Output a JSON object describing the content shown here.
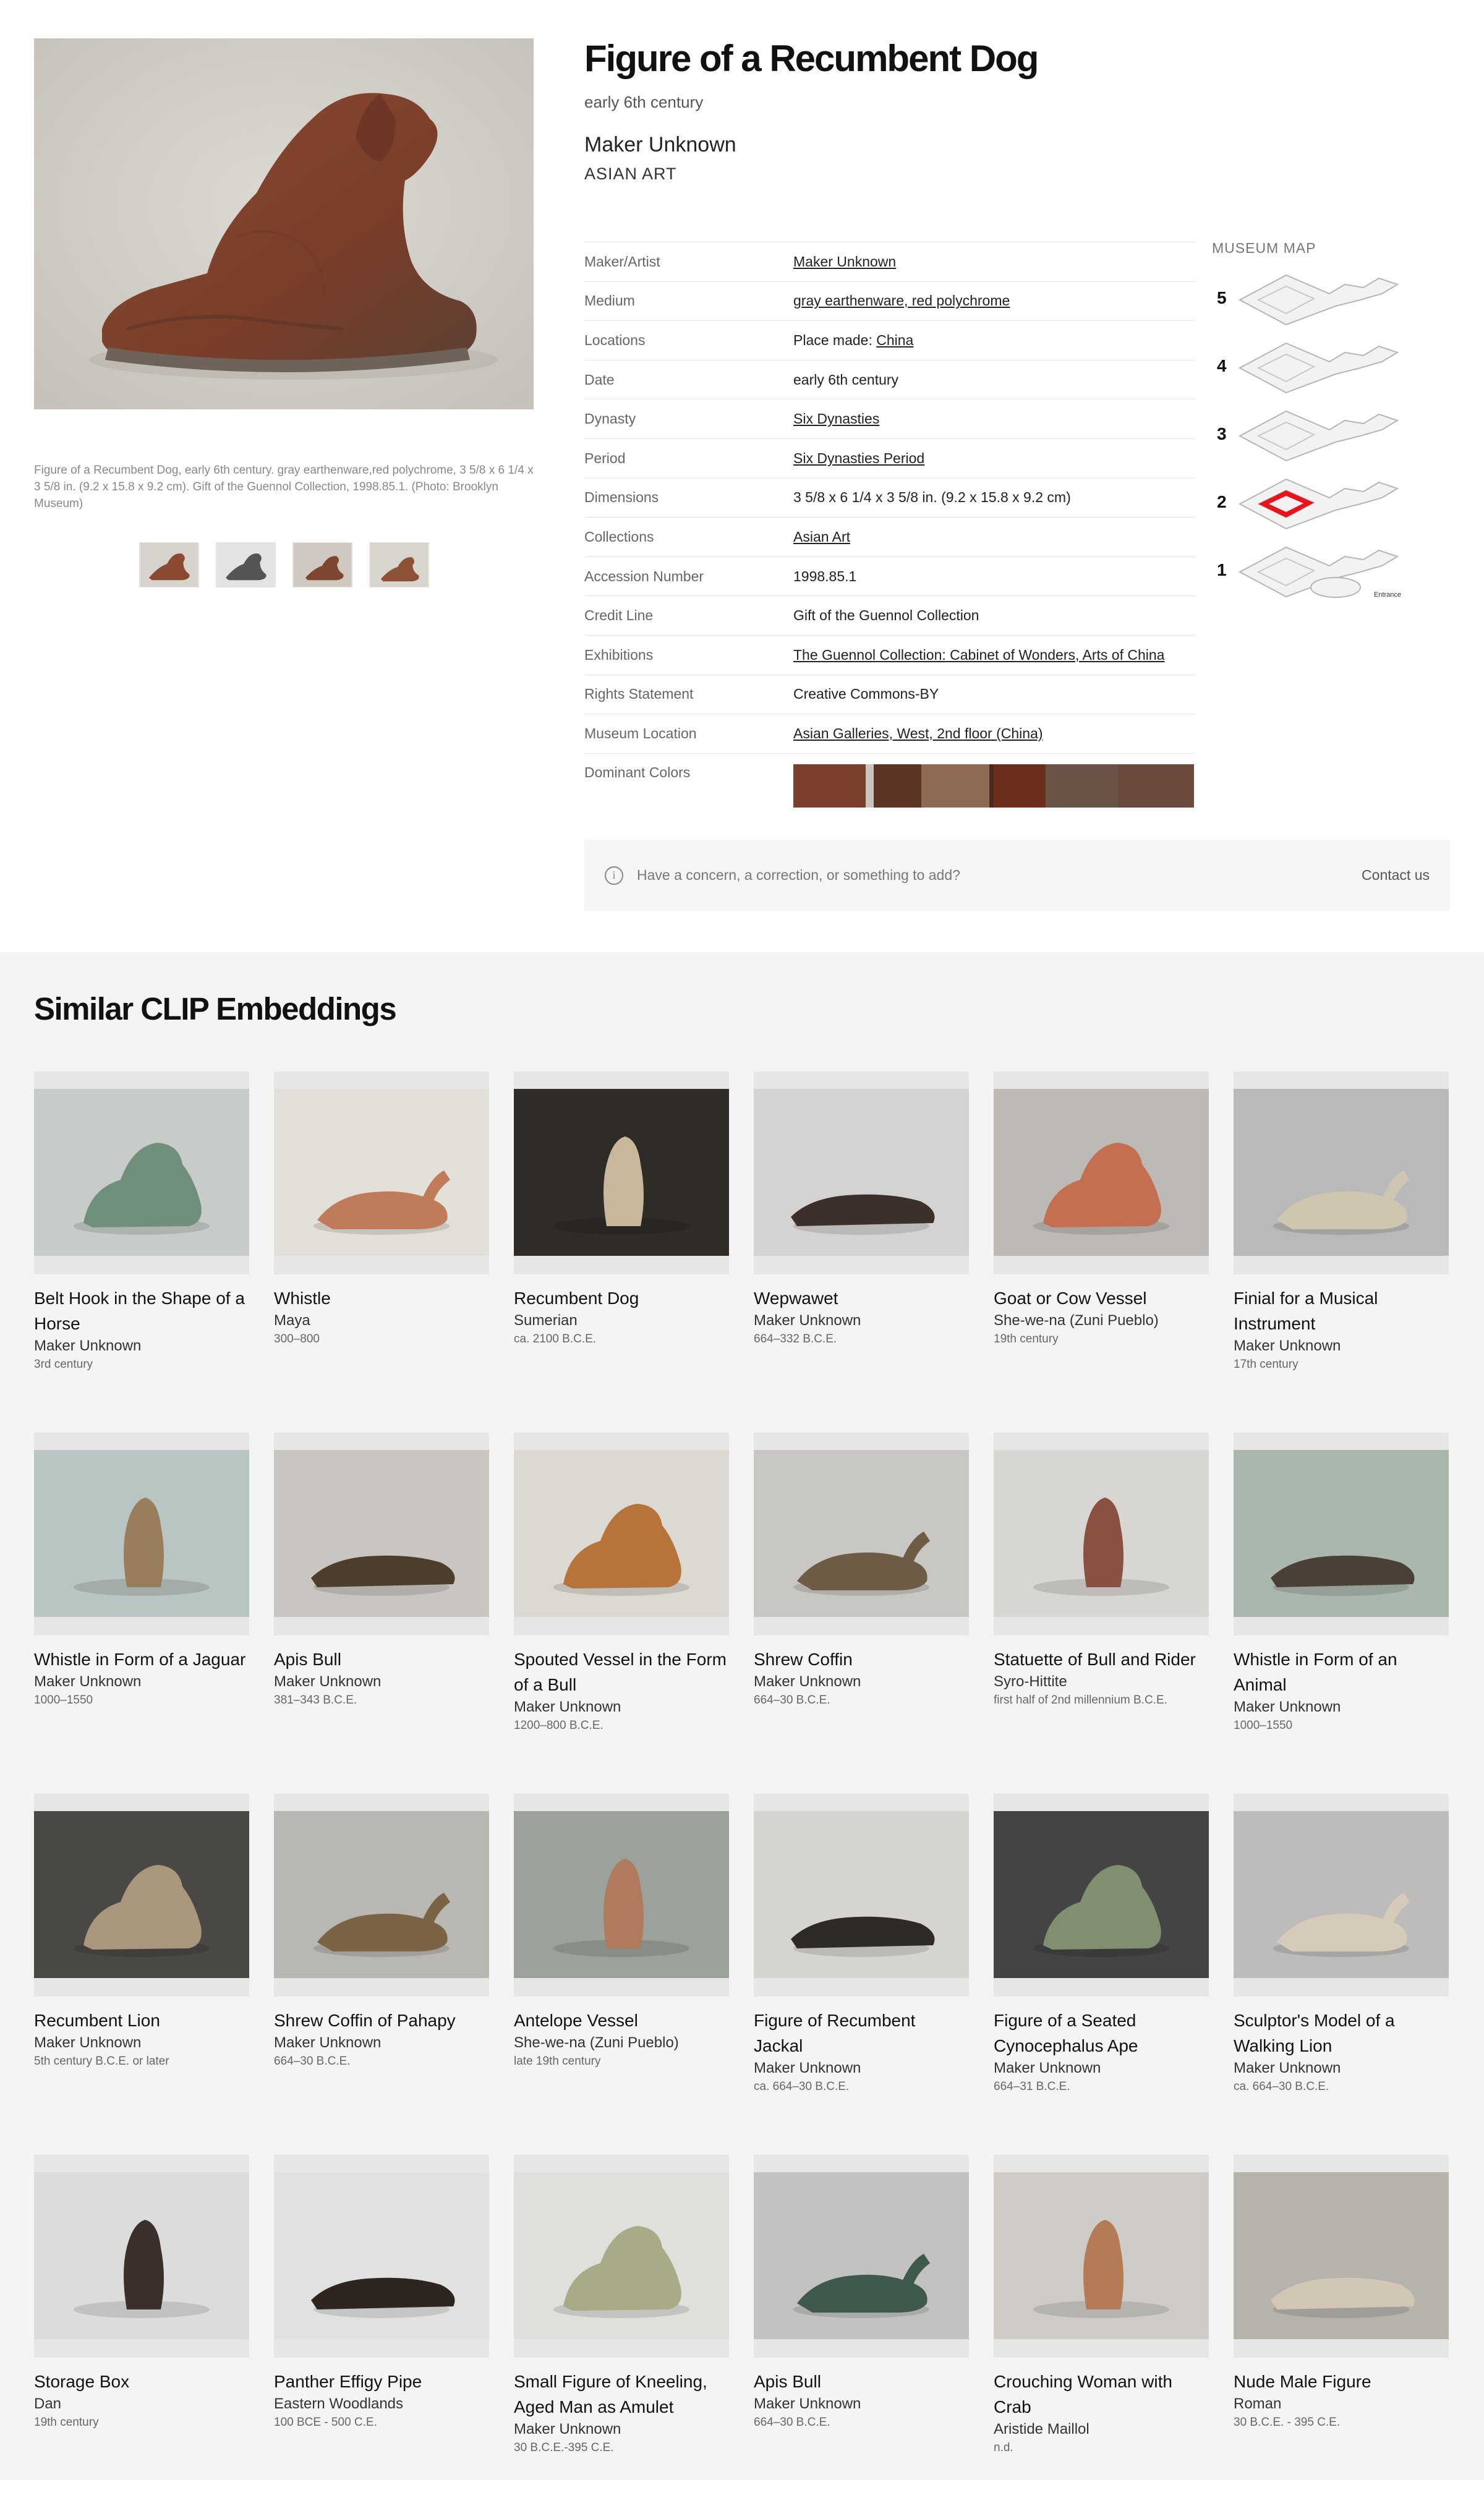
{
  "artwork": {
    "title": "Figure of a Recumbent Dog",
    "date": "early 6th century",
    "maker": "Maker Unknown",
    "department": "ASIAN ART",
    "caption": "Figure of a Recumbent Dog, early 6th century. gray earthenware,red polychrome, 3 5/8 x 6 1/4 x 3 5/8 in. (9.2 x 15.8 x 9.2 cm). Gift of the Guennol Collection, 1998.85.1. (Photo: Brooklyn Museum)"
  },
  "details": [
    {
      "label": "Maker/Artist",
      "value": "Maker Unknown",
      "link": true
    },
    {
      "label": "Medium",
      "value": "gray earthenware, red polychrome",
      "link": true
    },
    {
      "label": "Locations",
      "prefix": "Place made: ",
      "value": "China",
      "link": true
    },
    {
      "label": "Date",
      "value": "early 6th century",
      "link": false
    },
    {
      "label": "Dynasty",
      "value": "Six Dynasties",
      "link": true
    },
    {
      "label": "Period",
      "value": "Six Dynasties Period",
      "link": true
    },
    {
      "label": "Dimensions",
      "value": "3 5/8 x 6 1/4 x 3 5/8 in. (9.2 x 15.8 x 9.2 cm)",
      "link": false
    },
    {
      "label": "Collections",
      "value": "Asian Art",
      "link": true
    },
    {
      "label": "Accession Number",
      "value": "1998.85.1",
      "link": false
    },
    {
      "label": "Credit Line",
      "value": "Gift of the Guennol Collection",
      "link": false
    },
    {
      "label": "Exhibitions",
      "value": "The Guennol Collection: Cabinet of Wonders, Arts of China",
      "link": true
    },
    {
      "label": "Rights Statement",
      "value": "Creative Commons-BY",
      "link": false
    },
    {
      "label": "Museum Location",
      "value": "Asian Galleries, West, 2nd floor (China)",
      "link": true
    }
  ],
  "dominant_colors": {
    "label": "Dominant Colors",
    "swatches": [
      "#7a402b",
      "#c9c4bd",
      "#5b3424",
      "#8e6a55",
      "#4a2a1e",
      "#6b2f1c",
      "#6a5448",
      "#6a4b3d"
    ],
    "weights": [
      18,
      2,
      12,
      17,
      1,
      13,
      18,
      19
    ]
  },
  "museum_map": {
    "label": "MUSEUM MAP",
    "floors": [
      "5",
      "4",
      "3",
      "2",
      "1"
    ],
    "entrance_label": "Entrance",
    "highlight_floor": "2",
    "highlight_color": "#e8141b"
  },
  "concern": {
    "text": "Have a concern, a correction, or something to add?",
    "contact": "Contact us"
  },
  "similar": {
    "title": "Similar CLIP Embeddings",
    "items": [
      {
        "name": "Belt Hook in the Shape of a Horse",
        "maker": "Maker Unknown",
        "date": "3rd century",
        "bg": "#c7ccc9",
        "obj": "#6f8f7c"
      },
      {
        "name": "Whistle",
        "maker": "Maya",
        "date": "300–800",
        "bg": "#e3e0da",
        "obj": "#c07b5a"
      },
      {
        "name": "Recumbent Dog",
        "maker": "Sumerian",
        "date": "ca. 2100 B.C.E.",
        "bg": "#2f2b27",
        "obj": "#c9b79c"
      },
      {
        "name": "Wepwawet",
        "maker": "Maker Unknown",
        "date": "664–332 B.C.E.",
        "bg": "#d4d3d1",
        "obj": "#3b302b"
      },
      {
        "name": "Goat or Cow Vessel",
        "maker": "She-we-na (Zuni Pueblo)",
        "date": "19th century",
        "bg": "#bdbab5",
        "obj": "#c46f52"
      },
      {
        "name": "Finial for a Musical Instrument",
        "maker": "Maker Unknown",
        "date": "17th century",
        "bg": "#b8b9b8",
        "obj": "#cfc6b1"
      },
      {
        "name": "Whistle in Form of a Jaguar",
        "maker": "Maker Unknown",
        "date": "1000–1550",
        "bg": "#b9c5c2",
        "obj": "#9a7e5c"
      },
      {
        "name": "Apis Bull",
        "maker": "Maker Unknown",
        "date": "381–343 B.C.E.",
        "bg": "#c9c6c1",
        "obj": "#4d3d2c"
      },
      {
        "name": "Spouted Vessel in the Form of a Bull",
        "maker": "Maker Unknown",
        "date": "1200–800 B.C.E.",
        "bg": "#dcd9d3",
        "obj": "#b6733a"
      },
      {
        "name": "Shrew Coffin",
        "maker": "Maker Unknown",
        "date": "664–30 B.C.E.",
        "bg": "#c9c7c3",
        "obj": "#6e5c46"
      },
      {
        "name": "Statuette of Bull and Rider",
        "maker": "Syro-Hittite",
        "date": "first half of 2nd millennium B.C.E.",
        "bg": "#d8d6d2",
        "obj": "#8a5040"
      },
      {
        "name": "Whistle in Form of an Animal",
        "maker": "Maker Unknown",
        "date": "1000–1550",
        "bg": "#a9b7ac",
        "obj": "#4a4037"
      },
      {
        "name": "Recumbent Lion",
        "maker": "Maker Unknown",
        "date": "5th century B.C.E. or later",
        "bg": "#4a4844",
        "obj": "#a8977c"
      },
      {
        "name": "Shrew Coffin of Pahapy",
        "maker": "Maker Unknown",
        "date": "664–30 B.C.E.",
        "bg": "#b9b7b2",
        "obj": "#7b6445"
      },
      {
        "name": "Antelope Vessel",
        "maker": "She-we-na (Zuni Pueblo)",
        "date": "late 19th century",
        "bg": "#9aa29a",
        "obj": "#b07a5d"
      },
      {
        "name": "Figure of Recumbent Jackal",
        "maker": "Maker Unknown",
        "date": "ca. 664–30 B.C.E.",
        "bg": "#d6d4d0",
        "obj": "#2f2a28"
      },
      {
        "name": "Figure of a Seated Cynocephalus Ape",
        "maker": "Maker Unknown",
        "date": "664–31 B.C.E.",
        "bg": "#444444",
        "obj": "#7f8f6f"
      },
      {
        "name": "Sculptor's Model of a Walking Lion",
        "maker": "Maker Unknown",
        "date": "ca. 664–30 B.C.E.",
        "bg": "#bdbcba",
        "obj": "#d6cbbb"
      },
      {
        "name": "Storage Box",
        "maker": "Dan",
        "date": "19th century",
        "bg": "#dcdcdc",
        "obj": "#3a2f2a"
      },
      {
        "name": "Panther Effigy Pipe",
        "maker": "Eastern Woodlands",
        "date": "100 BCE - 500 C.E.",
        "bg": "#e1e1e1",
        "obj": "#2f2520"
      },
      {
        "name": "Small Figure of Kneeling, Aged Man as Amulet",
        "maker": "Maker Unknown",
        "date": "30 B.C.E.-395 C.E.",
        "bg": "#dfdfdc",
        "obj": "#a8ab86"
      },
      {
        "name": "Apis Bull",
        "maker": "Maker Unknown",
        "date": "664–30 B.C.E.",
        "bg": "#c2c3c1",
        "obj": "#3f5a4a"
      },
      {
        "name": "Crouching Woman with Crab",
        "maker": "Aristide Maillol",
        "date": "n.d.",
        "bg": "#cfccc8",
        "obj": "#b57a56"
      },
      {
        "name": "Nude Male Figure",
        "maker": "Roman",
        "date": "30 B.C.E. - 395 C.E.",
        "bg": "#b6b3ad",
        "obj": "#d2c7b5"
      }
    ]
  }
}
